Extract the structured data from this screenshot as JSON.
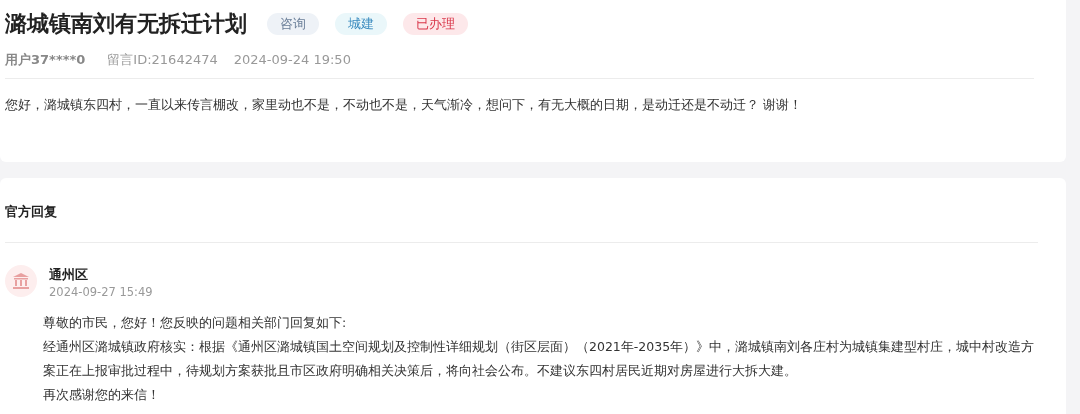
{
  "question": {
    "title": "潞城镇南刘有无拆迁计划",
    "tags": [
      {
        "label": "咨询",
        "color": "#eef2f7"
      },
      {
        "label": "城建",
        "color": "#eaf7fa"
      },
      {
        "label": "已办理",
        "color": "#fde8ea"
      }
    ],
    "user": "用户37****0",
    "message_id": "留言ID:21642474",
    "time": "2024-09-24 19:50",
    "body": "您好，潞城镇东四村，一直以来传言棚改，家里动也不是，不动也不是，天气渐冷，想问下，有无大概的日期，是动迁还是不动迁？ 谢谢！"
  },
  "reply": {
    "heading": "官方回复",
    "department": "通州区",
    "time": "2024-09-27 15:49",
    "paragraphs": [
      "尊敬的市民，您好！您反映的问题相关部门回复如下:",
      "经通州区潞城镇政府核实：根据《通州区潞城镇国土空间规划及控制性详细规划（街区层面）（2021年-2035年）》中，潞城镇南刘各庄村为城镇集建型村庄，城中村改造方案正在上报审批过程中，待规划方案获批且市区政府明确相关决策后，将向社会公布。不建议东四村居民近期对房屋进行大拆大建。",
      "再次感谢您的来信！"
    ]
  }
}
